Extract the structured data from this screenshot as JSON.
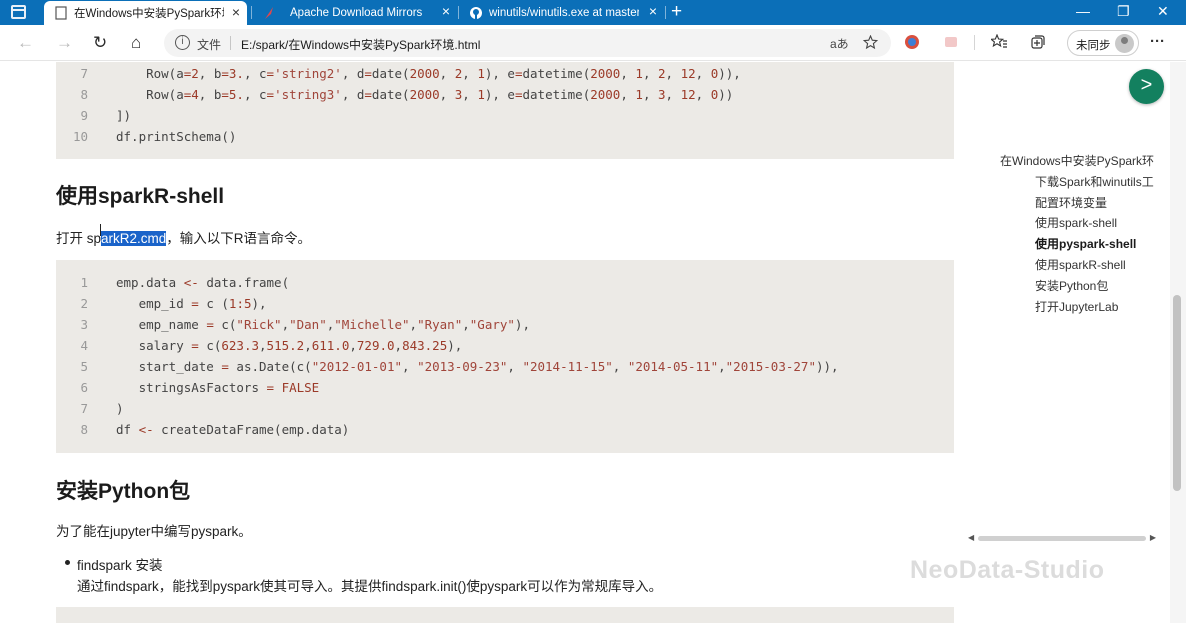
{
  "tabs": [
    {
      "title": "在Windows中安装PySpark环境 -",
      "active": true,
      "icon": "page-icon"
    },
    {
      "title": "Apache Download Mirrors",
      "active": false,
      "icon": "apache-feather-icon"
    },
    {
      "title": "winutils/winutils.exe at master",
      "active": false,
      "icon": "github-icon"
    }
  ],
  "tab_close": "×",
  "new_tab": "+",
  "window_controls": {
    "minimize": "—",
    "restore": "❐",
    "close": "✕"
  },
  "toolbar": {
    "back": "←",
    "forward": "→",
    "refresh": "↻",
    "home": "⌂",
    "info": "i",
    "file_label": "文件",
    "url": "E:/spark/在Windows中安装PySpark环境.html",
    "read_aloud": "aあ",
    "profile_label": "未同步",
    "more": "···"
  },
  "code_top": {
    "lines": [
      {
        "n": "7",
        "parts": [
          [
            "",
            "    Row(a"
          ],
          [
            "op",
            "="
          ],
          [
            "num",
            "2"
          ],
          [
            "",
            ", b"
          ],
          [
            "op",
            "="
          ],
          [
            "num",
            "3."
          ],
          [
            "",
            ", c"
          ],
          [
            "op",
            "="
          ],
          [
            "str",
            "'string2'"
          ],
          [
            "",
            ", d"
          ],
          [
            "op",
            "="
          ],
          [
            "",
            "date("
          ],
          [
            "num",
            "2000"
          ],
          [
            "",
            ", "
          ],
          [
            "num",
            "2"
          ],
          [
            "",
            ", "
          ],
          [
            "num",
            "1"
          ],
          [
            "",
            "), e"
          ],
          [
            "op",
            "="
          ],
          [
            "",
            "datetime("
          ],
          [
            "num",
            "2000"
          ],
          [
            "",
            ", "
          ],
          [
            "num",
            "1"
          ],
          [
            "",
            ", "
          ],
          [
            "num",
            "2"
          ],
          [
            "",
            ", "
          ],
          [
            "num",
            "12"
          ],
          [
            "",
            ", "
          ],
          [
            "num",
            "0"
          ],
          [
            "",
            ")),"
          ]
        ]
      },
      {
        "n": "8",
        "parts": [
          [
            "",
            "    Row(a"
          ],
          [
            "op",
            "="
          ],
          [
            "num",
            "4"
          ],
          [
            "",
            ", b"
          ],
          [
            "op",
            "="
          ],
          [
            "num",
            "5."
          ],
          [
            "",
            ", c"
          ],
          [
            "op",
            "="
          ],
          [
            "str",
            "'string3'"
          ],
          [
            "",
            ", d"
          ],
          [
            "op",
            "="
          ],
          [
            "",
            "date("
          ],
          [
            "num",
            "2000"
          ],
          [
            "",
            ", "
          ],
          [
            "num",
            "3"
          ],
          [
            "",
            ", "
          ],
          [
            "num",
            "1"
          ],
          [
            "",
            "), e"
          ],
          [
            "op",
            "="
          ],
          [
            "",
            "datetime("
          ],
          [
            "num",
            "2000"
          ],
          [
            "",
            ", "
          ],
          [
            "num",
            "1"
          ],
          [
            "",
            ", "
          ],
          [
            "num",
            "3"
          ],
          [
            "",
            ", "
          ],
          [
            "num",
            "12"
          ],
          [
            "",
            ", "
          ],
          [
            "num",
            "0"
          ],
          [
            "",
            "))"
          ]
        ]
      },
      {
        "n": "9",
        "parts": [
          [
            "",
            "])"
          ]
        ]
      },
      {
        "n": "10",
        "parts": [
          [
            "",
            "df.printSchema()"
          ]
        ]
      }
    ]
  },
  "section_sparkr": {
    "heading": "使用sparkR-shell",
    "para_before": "打开 sp",
    "para_selected": "arkR2.cmd",
    "para_after": "，输入以下R语言命令。"
  },
  "code_r": {
    "lines": [
      {
        "n": "1",
        "parts": [
          [
            "",
            "emp.data "
          ],
          [
            "op",
            "<-"
          ],
          [
            "",
            " data.frame("
          ]
        ]
      },
      {
        "n": "2",
        "parts": [
          [
            "",
            "   emp_id "
          ],
          [
            "op",
            "="
          ],
          [
            "",
            " c ("
          ],
          [
            "num",
            "1"
          ],
          [
            "op",
            ":"
          ],
          [
            "num",
            "5"
          ],
          [
            "",
            "),"
          ]
        ]
      },
      {
        "n": "3",
        "parts": [
          [
            "",
            "   emp_name "
          ],
          [
            "op",
            "="
          ],
          [
            "",
            " c("
          ],
          [
            "str",
            "\"Rick\""
          ],
          [
            "",
            ","
          ],
          [
            "str",
            "\"Dan\""
          ],
          [
            "",
            ","
          ],
          [
            "str",
            "\"Michelle\""
          ],
          [
            "",
            ","
          ],
          [
            "str",
            "\"Ryan\""
          ],
          [
            "",
            ","
          ],
          [
            "str",
            "\"Gary\""
          ],
          [
            "",
            "),"
          ]
        ]
      },
      {
        "n": "4",
        "parts": [
          [
            "",
            "   salary "
          ],
          [
            "op",
            "="
          ],
          [
            "",
            " c("
          ],
          [
            "num",
            "623.3"
          ],
          [
            "",
            ","
          ],
          [
            "num",
            "515.2"
          ],
          [
            "",
            ","
          ],
          [
            "num",
            "611.0"
          ],
          [
            "",
            ","
          ],
          [
            "num",
            "729.0"
          ],
          [
            "",
            ","
          ],
          [
            "num",
            "843.25"
          ],
          [
            "",
            "),"
          ]
        ]
      },
      {
        "n": "5",
        "parts": [
          [
            "",
            "   start_date "
          ],
          [
            "op",
            "="
          ],
          [
            "",
            " as.Date(c("
          ],
          [
            "str",
            "\"2012-01-01\""
          ],
          [
            "",
            ", "
          ],
          [
            "str",
            "\"2013-09-23\""
          ],
          [
            "",
            ", "
          ],
          [
            "str",
            "\"2014-11-15\""
          ],
          [
            "",
            ", "
          ],
          [
            "str",
            "\"2014-05-11\""
          ],
          [
            "",
            ","
          ],
          [
            "str",
            "\"2015-03-27\""
          ],
          [
            "",
            ")),"
          ]
        ]
      },
      {
        "n": "6",
        "parts": [
          [
            "",
            "   stringsAsFactors "
          ],
          [
            "op",
            "="
          ],
          [
            "const",
            " FALSE"
          ]
        ]
      },
      {
        "n": "7",
        "parts": [
          [
            "",
            ")"
          ]
        ]
      },
      {
        "n": "8",
        "parts": [
          [
            "",
            "df "
          ],
          [
            "op",
            "<-"
          ],
          [
            "",
            " createDataFrame(emp.data)"
          ]
        ]
      }
    ]
  },
  "section_python": {
    "heading": "安装Python包",
    "para": "为了能在jupyter中编写pyspark。",
    "bullet_title": "findspark 安装",
    "bullet_desc": "通过findspark，能找到pyspark使其可导入。其提供findspark.init()使pyspark可以作为常规库导入。"
  },
  "toc": {
    "go_label": ">",
    "items": [
      {
        "label": "在Windows中安装PySpark环",
        "level": 0,
        "active": false
      },
      {
        "label": "下载Spark和winutils工",
        "level": 1,
        "active": false
      },
      {
        "label": "配置环境变量",
        "level": 1,
        "active": false
      },
      {
        "label": "使用spark-shell",
        "level": 1,
        "active": false
      },
      {
        "label": "使用pyspark-shell",
        "level": 1,
        "active": true
      },
      {
        "label": "使用sparkR-shell",
        "level": 1,
        "active": false
      },
      {
        "label": "安装Python包",
        "level": 1,
        "active": false
      },
      {
        "label": "打开JupyterLab",
        "level": 1,
        "active": false
      }
    ]
  },
  "scrollbar": {
    "left_arrow": "◀",
    "right_arrow": "▶"
  },
  "watermark": "NeoData-Studio"
}
